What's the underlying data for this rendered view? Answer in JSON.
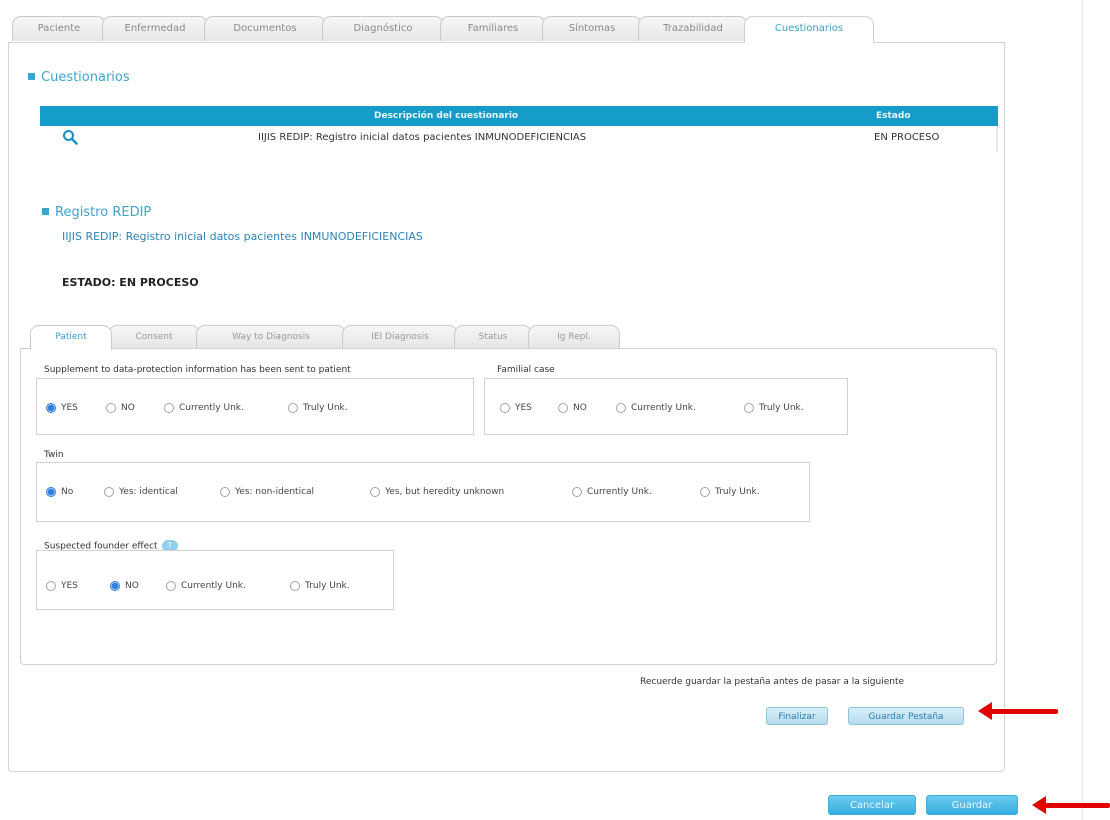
{
  "top_tabs": [
    "Paciente",
    "Enfermedad",
    "Documentos",
    "Diagnóstico",
    "Familiares",
    "Síntomas",
    "Trazabilidad",
    "Cuestionarios"
  ],
  "active_top_tab": "Cuestionarios",
  "cuestionarios": {
    "title": "Cuestionarios",
    "columns": [
      "Descripción del cuestionario",
      "Estado"
    ],
    "rows": [
      {
        "icon": "search-icon",
        "description": "IIJIS REDIP: Registro inicial datos pacientes INMUNODEFICIENCIAS",
        "estado": "EN PROCESO"
      }
    ]
  },
  "registro": {
    "title": "Registro REDIP",
    "subtitle": "IIJIS REDIP: Registro inicial datos pacientes INMUNODEFICIENCIAS",
    "estado": "ESTADO: EN PROCESO"
  },
  "inner_tabs": [
    "Patient",
    "Consent",
    "Way to Diagnosis",
    "IEI Diagnosis",
    "Status",
    "Ig Repl."
  ],
  "active_inner_tab": "Patient",
  "form": {
    "supplement": {
      "label": "Supplement to data-protection information has been sent to patient",
      "options": [
        "YES",
        "NO",
        "Currently Unk.",
        "Truly Unk."
      ],
      "selected": "YES"
    },
    "familial": {
      "label": "Familial case",
      "options": [
        "YES",
        "NO",
        "Currently Unk.",
        "Truly Unk."
      ],
      "selected": null
    },
    "twin": {
      "label": "Twin",
      "options": [
        "No",
        "Yes: identical",
        "Yes: non-identical",
        "Yes, but heredity unknown",
        "Currently Unk.",
        "Truly Unk."
      ],
      "selected": "No"
    },
    "founder": {
      "label": "Suspected founder effect",
      "help": "?",
      "options": [
        "YES",
        "NO",
        "Currently Unk.",
        "Truly Unk."
      ],
      "selected": "NO"
    }
  },
  "reminder": "Recuerde guardar la pestaña antes de pasar a la siguiente",
  "buttons": {
    "finalizar": "Finalizar",
    "guardar_pestana": "Guardar Pestaña",
    "cancelar": "Cancelar",
    "guardar": "Guardar"
  },
  "colors": {
    "accent": "#3da4cf",
    "table_header": "#169cc8",
    "arrow": "#e00000"
  }
}
